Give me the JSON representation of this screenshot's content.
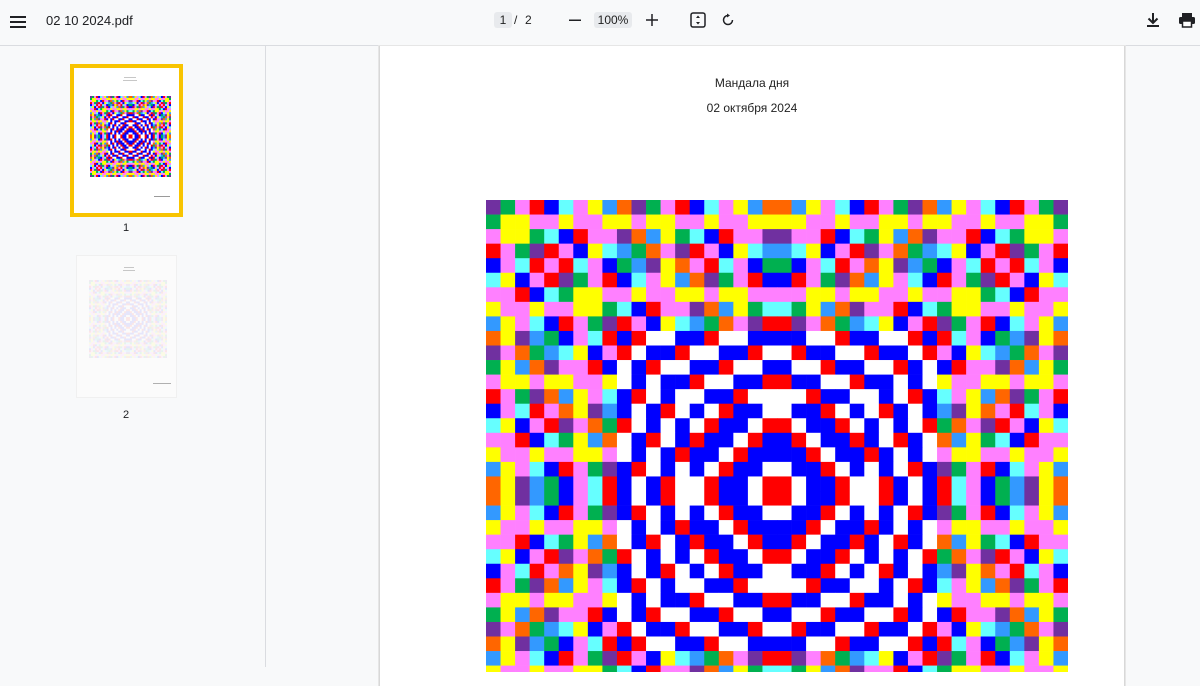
{
  "toolbar": {
    "file_name": "02 10 2024.pdf",
    "current_page": "1",
    "page_separator": "/",
    "total_pages": "2",
    "zoom_level": "100%",
    "icons": {
      "menu": "menu-icon",
      "zoom_out": "minus-icon",
      "zoom_in": "plus-icon",
      "fit": "fit-page-icon",
      "rotate": "rotate-icon",
      "download": "download-icon",
      "print": "print-icon"
    }
  },
  "sidebar": {
    "thumbnails": [
      {
        "label": "1",
        "selected": true
      },
      {
        "label": "2",
        "selected": false
      }
    ],
    "selection_color": "#f8c400"
  },
  "document": {
    "title": "Мандала дня",
    "date": "02 октября 2024"
  },
  "mandala": {
    "palette": [
      "#ff80ff",
      "#7030a0",
      "#0000ff",
      "#ff0000",
      "#ffff00",
      "#00b050",
      "#66ffff",
      "#ff6600",
      "#3399ff",
      "#ffffff"
    ]
  }
}
